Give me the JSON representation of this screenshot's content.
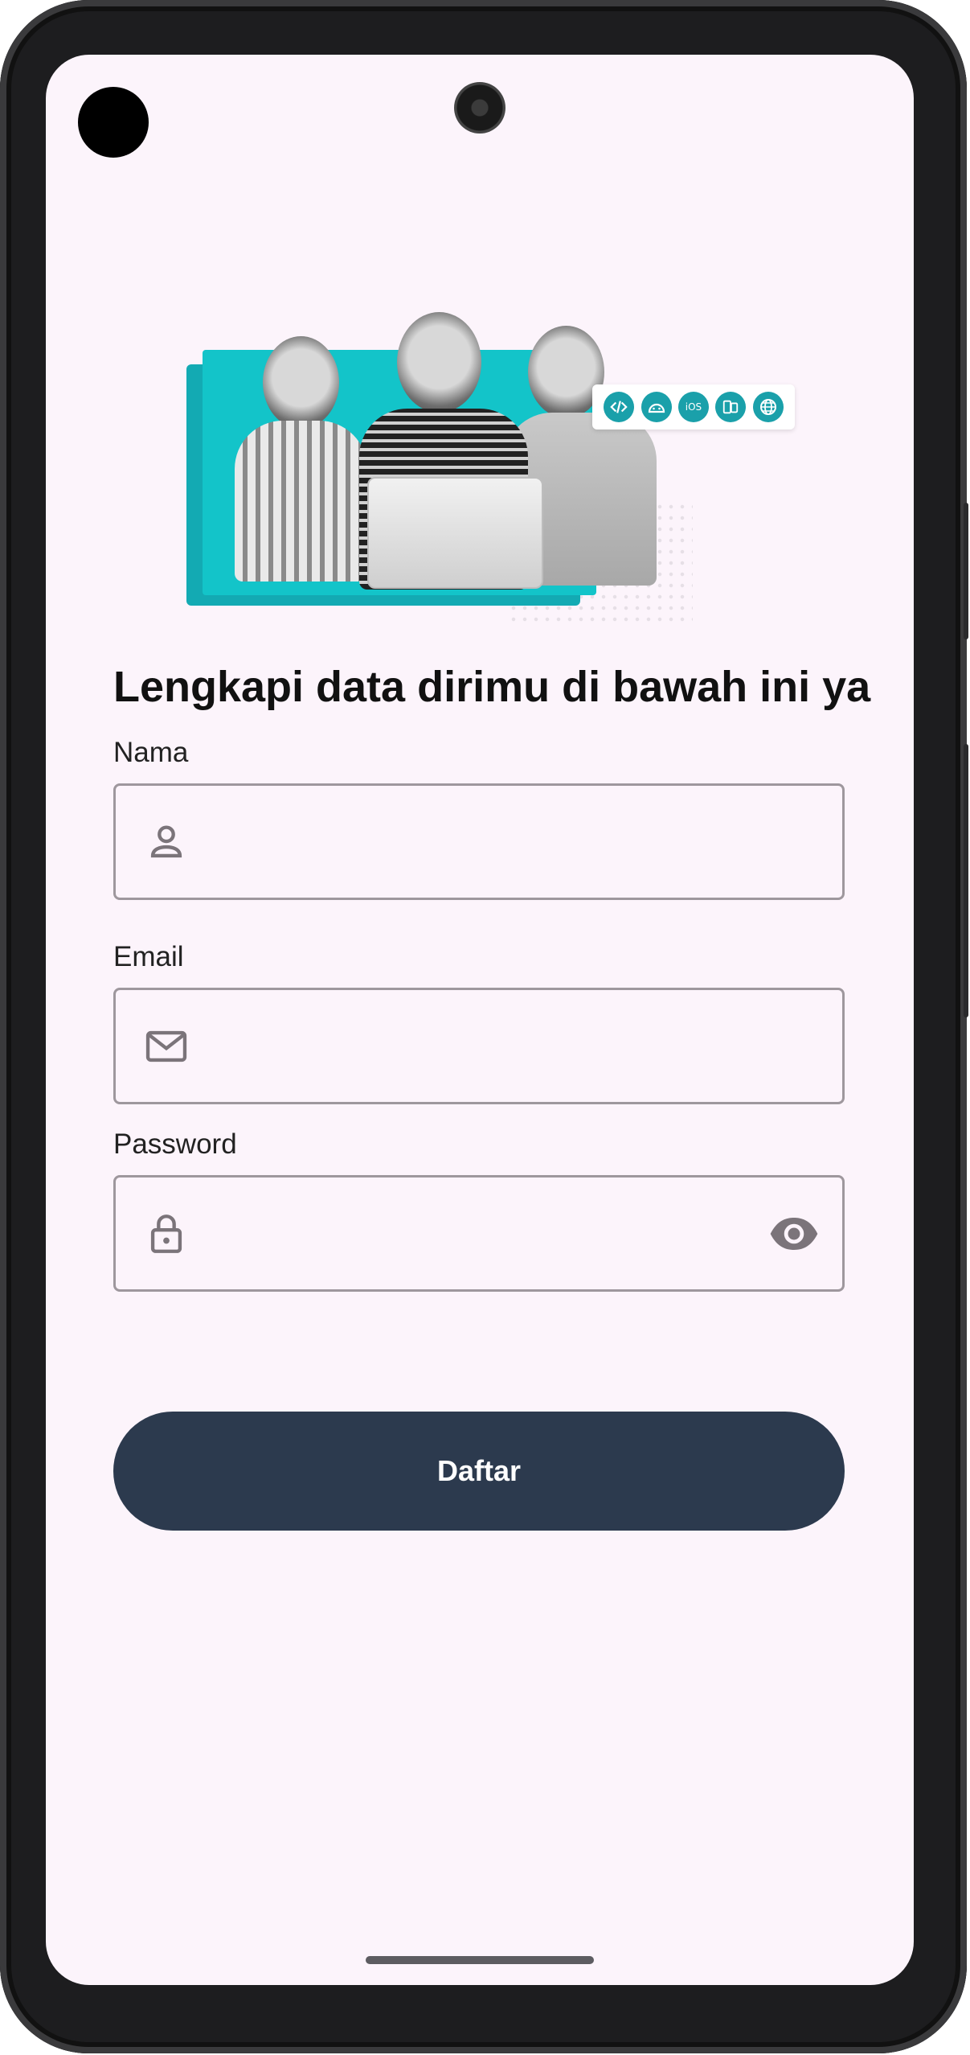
{
  "illustration": {
    "strip_icons": [
      "code-icon",
      "android-icon",
      "iOS",
      "devices-icon",
      "web-icon"
    ]
  },
  "form": {
    "title": "Lengkapi data dirimu di bawah ini ya",
    "name_label": "Nama",
    "email_label": "Email",
    "password_label": "Password",
    "name_value": "",
    "email_value": "",
    "password_value": "",
    "submit_label": "Daftar"
  },
  "colors": {
    "background": "#fcf4fb",
    "accent_teal": "#13c4c9",
    "button": "#2c3a4e",
    "field_border": "#9e979d"
  }
}
